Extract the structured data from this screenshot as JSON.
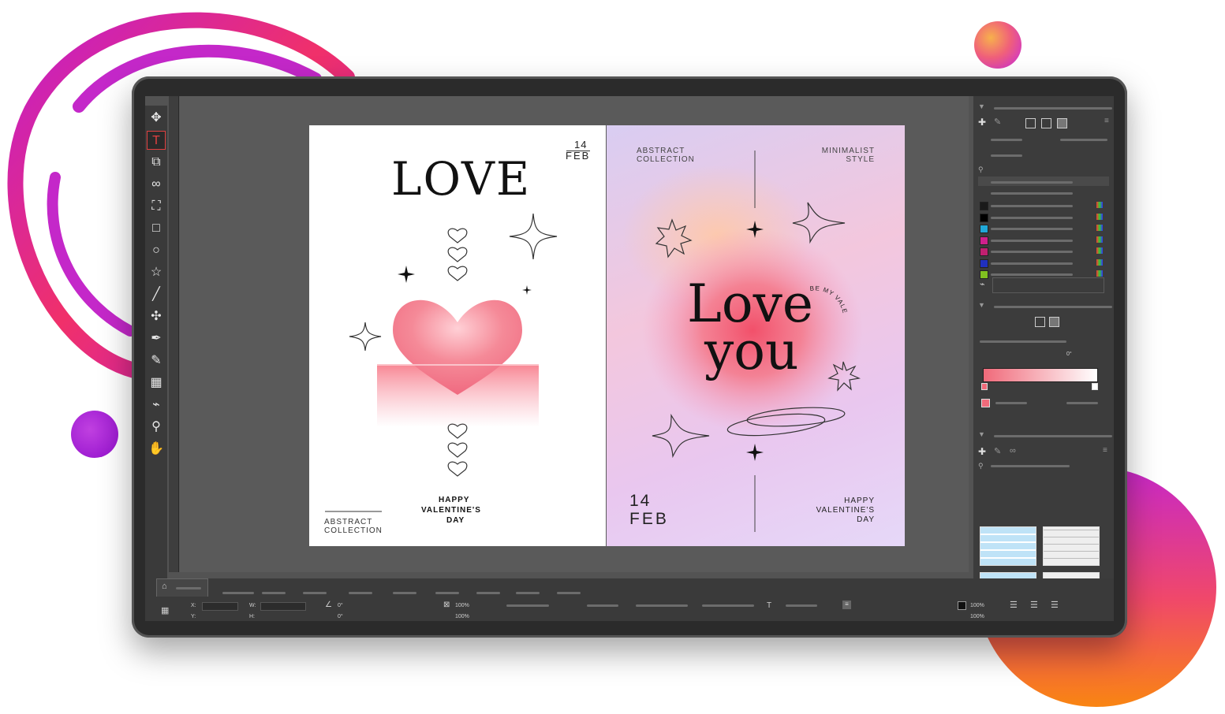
{
  "toolbar": {
    "tools": [
      {
        "name": "move-tool-icon",
        "glyph": "✥"
      },
      {
        "name": "type-tool-icon",
        "glyph": "T"
      },
      {
        "name": "shape-builder-icon",
        "glyph": "⧉"
      },
      {
        "name": "link-tool-icon",
        "glyph": "∞"
      },
      {
        "name": "image-frame-icon",
        "glyph": "⛶"
      },
      {
        "name": "rectangle-tool-icon",
        "glyph": "□"
      },
      {
        "name": "ellipse-tool-icon",
        "glyph": "○"
      },
      {
        "name": "polygon-tool-icon",
        "glyph": "☆"
      },
      {
        "name": "line-tool-icon",
        "glyph": "╱"
      },
      {
        "name": "node-tool-icon",
        "glyph": "✣"
      },
      {
        "name": "pen-tool-icon",
        "glyph": "✒"
      },
      {
        "name": "pencil-tool-icon",
        "glyph": "✎"
      },
      {
        "name": "table-tool-icon",
        "glyph": "▦"
      },
      {
        "name": "eyedropper-tool-icon",
        "glyph": "⌁"
      },
      {
        "name": "zoom-tool-icon",
        "glyph": "⚲"
      },
      {
        "name": "hand-tool-icon",
        "glyph": "✋"
      }
    ]
  },
  "left_page": {
    "date_day": "14",
    "date_month": "FEB",
    "title": "LOVE",
    "footer_left_1": "ABSTRACT",
    "footer_left_2": "COLLECTION",
    "footer_center_1": "HAPPY",
    "footer_center_2": "VALENTINE'S",
    "footer_center_3": "DAY"
  },
  "right_page": {
    "top_left_1": "ABSTRACT",
    "top_left_2": "COLLECTION",
    "top_right_1": "MINIMALIST",
    "top_right_2": "STYLE",
    "headline_1": "Love",
    "headline_2": "you",
    "curved_text": "BE MY VALENTINE",
    "date_day": "14",
    "date_month": "FEB",
    "footer_1": "HAPPY",
    "footer_2": "VALENTINE'S",
    "footer_3": "DAY"
  },
  "bottom_bar": {
    "x_label": "X:",
    "y_label": "Y:",
    "w_label": "W:",
    "h_label": "H:",
    "rotate_value": "0°",
    "shear_value": "0°",
    "scale_x": "100%",
    "scale_y": "100%",
    "opacity_1": "100%",
    "opacity_2": "100%"
  },
  "panel": {
    "gradient_angle": "0°",
    "swatch_colors": [
      "#1a1a1a",
      "#000000",
      "#20a8d8",
      "#d0208c",
      "#c02070",
      "#2030c0",
      "#80c020"
    ]
  },
  "colors": {
    "orange_ring": "#f57a1c",
    "magenta": "#c427c9",
    "accent_red": "#e04040"
  }
}
